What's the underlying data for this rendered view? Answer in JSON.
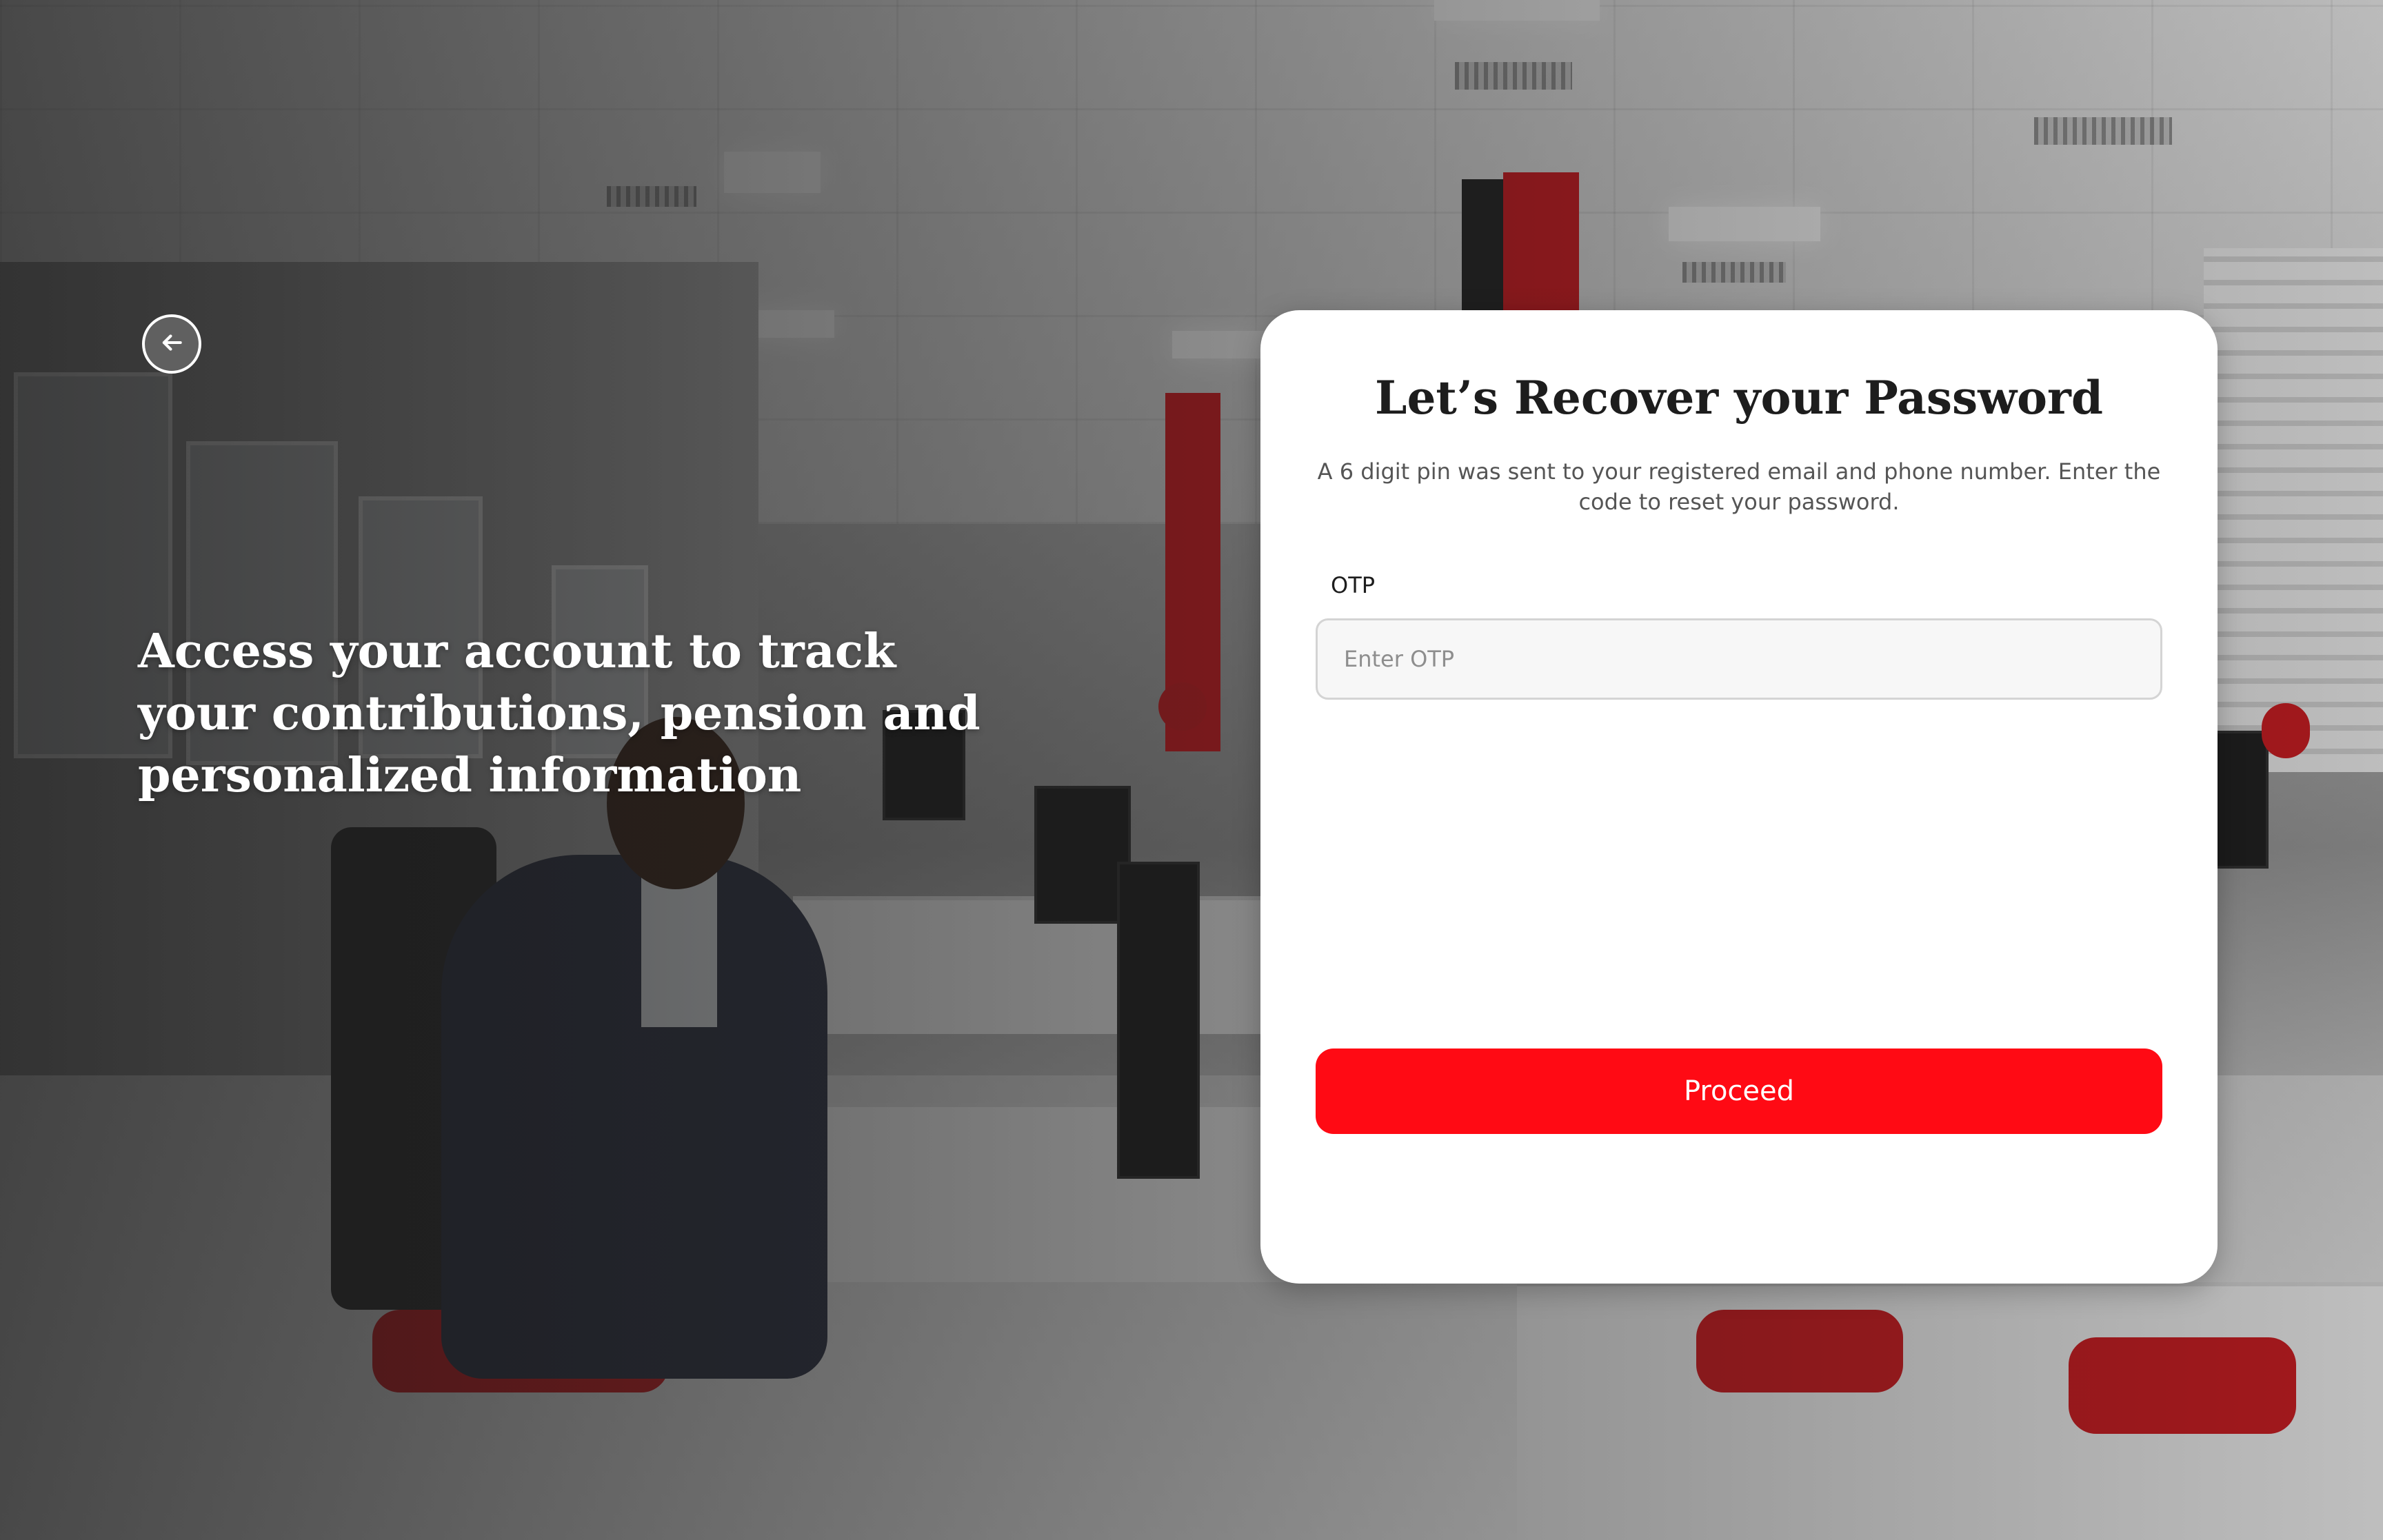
{
  "left_panel": {
    "tagline": "Access your account to track your contributions, pension and personalized information"
  },
  "back_button": {
    "icon": "arrow-left-icon",
    "glyph": "←"
  },
  "recover_card": {
    "title": "Let’s Recover your Password",
    "subtitle": "A 6 digit pin was sent to your registered email and phone number. Enter the code to reset your password.",
    "otp_label": "OTP",
    "otp_placeholder": "Enter OTP",
    "otp_value": "",
    "proceed_label": "Proceed"
  },
  "colors": {
    "accent": "#ff0a14",
    "card_background": "#ffffff",
    "title_text": "#1d1d1d",
    "subtitle_text": "#555555"
  }
}
